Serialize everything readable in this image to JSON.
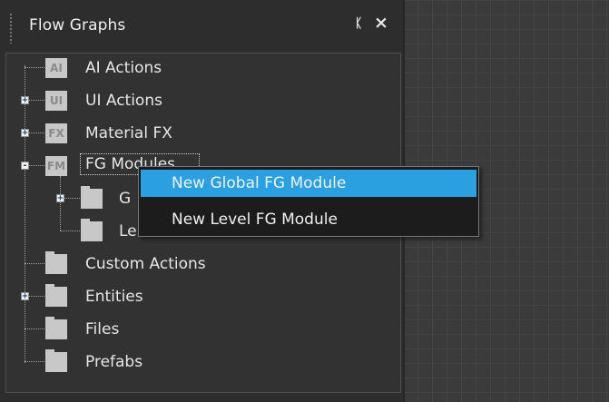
{
  "panel": {
    "title": "Flow Graphs",
    "pin_glyph": "᎗",
    "close_glyph": "✕"
  },
  "tree": {
    "items": [
      {
        "icon_text": "AI",
        "label": "AI Actions",
        "expander": ""
      },
      {
        "icon_text": "UI",
        "label": "UI Actions",
        "expander": "+"
      },
      {
        "icon_text": "FX",
        "label": "Material FX",
        "expander": "+"
      },
      {
        "icon_text": "FM",
        "label": "FG Modules",
        "expander": "-"
      },
      {
        "icon_text": "",
        "label": "G",
        "expander": "+"
      },
      {
        "icon_text": "",
        "label": "Le",
        "expander": ""
      },
      {
        "icon_text": "",
        "label": "Custom Actions",
        "expander": ""
      },
      {
        "icon_text": "",
        "label": "Entities",
        "expander": "+"
      },
      {
        "icon_text": "",
        "label": "Files",
        "expander": ""
      },
      {
        "icon_text": "",
        "label": "Prefabs",
        "expander": ""
      }
    ]
  },
  "context_menu": {
    "items": [
      {
        "label": "New Global FG Module",
        "highlighted": true
      },
      {
        "label": "New Level FG Module",
        "highlighted": false
      }
    ]
  },
  "colors": {
    "menu_highlight": "#2aa0e0",
    "panel_bg": "#2d2d2d"
  }
}
